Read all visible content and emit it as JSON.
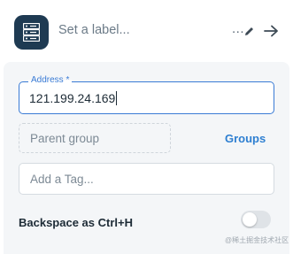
{
  "header": {
    "icon": "server-icon",
    "label_placeholder": "Set a label...",
    "more_dots": "...",
    "edit_icon": "pencil-icon",
    "forward_icon": "arrow-right-icon"
  },
  "form": {
    "address_label": "Address *",
    "address_value": "121.199.24.169",
    "parent_group_placeholder": "Parent group",
    "groups_link": "Groups",
    "tag_placeholder": "Add a Tag...",
    "backspace_label": "Backspace as Ctrl+H",
    "backspace_enabled": false
  },
  "colors": {
    "accent": "#3a7bd5",
    "link": "#2e7fd1",
    "icon_bg": "#1e3a52",
    "panel_bg": "#f4f6f8"
  },
  "watermark": "@稀土掘金技术社区"
}
